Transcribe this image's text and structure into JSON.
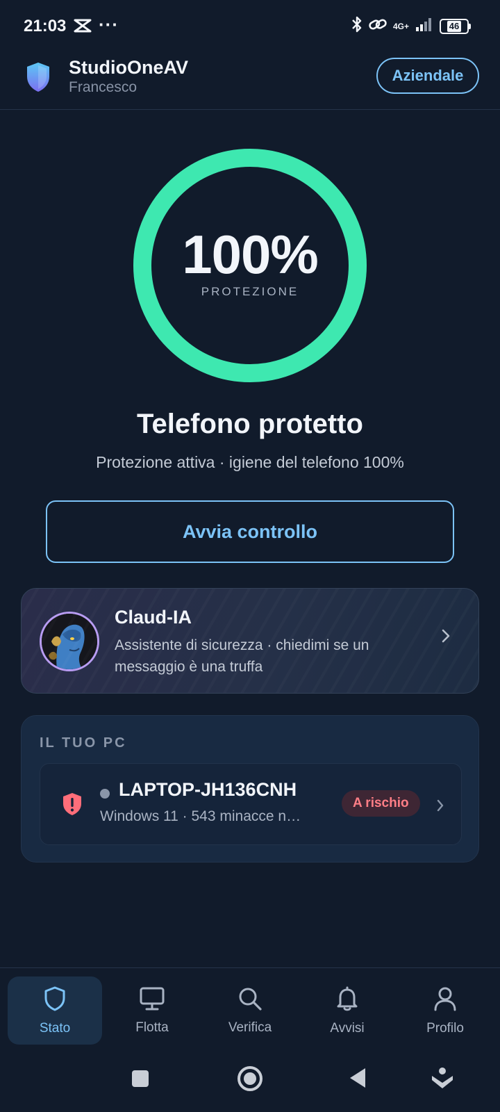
{
  "status_bar": {
    "time": "21:03",
    "dots": "···",
    "network": "4G+",
    "battery": "46",
    "icons": [
      "capcut-icon",
      "bluetooth-icon",
      "link-icon",
      "signal-icon",
      "battery-icon"
    ]
  },
  "header": {
    "app_name": "StudioOneAV",
    "user_name": "Francesco",
    "mode_button": "Aziendale"
  },
  "protection": {
    "percent_text": "100%",
    "percent_value": 100,
    "label": "PROTEZIONE",
    "title": "Telefono protetto",
    "subtitle": "Protezione attiva · igiene del telefono 100%",
    "ring_color": "#3ee8b0"
  },
  "check_button": "Avvia controllo",
  "assistant": {
    "title": "Claud-IA",
    "description": "Assistente di sicurezza · chiedimi se un messaggio è una truffa"
  },
  "pc": {
    "section_title": "IL TUO PC",
    "device_name": "LAPTOP-JH136CNH",
    "device_desc": "Windows 11 · 543 minacce n…",
    "badge": "A rischio",
    "badge_color": "#ff7e86"
  },
  "nav": {
    "items": [
      {
        "label": "Stato",
        "icon": "shield-icon",
        "active": true
      },
      {
        "label": "Flotta",
        "icon": "monitor-icon",
        "active": false
      },
      {
        "label": "Verifica",
        "icon": "search-icon",
        "active": false
      },
      {
        "label": "Avvisi",
        "icon": "bell-icon",
        "active": false
      },
      {
        "label": "Profilo",
        "icon": "user-icon",
        "active": false
      }
    ]
  },
  "colors": {
    "background": "#111b2b",
    "accent": "#7cc3f7",
    "success": "#3ee8b0",
    "danger": "#ff7e86"
  }
}
